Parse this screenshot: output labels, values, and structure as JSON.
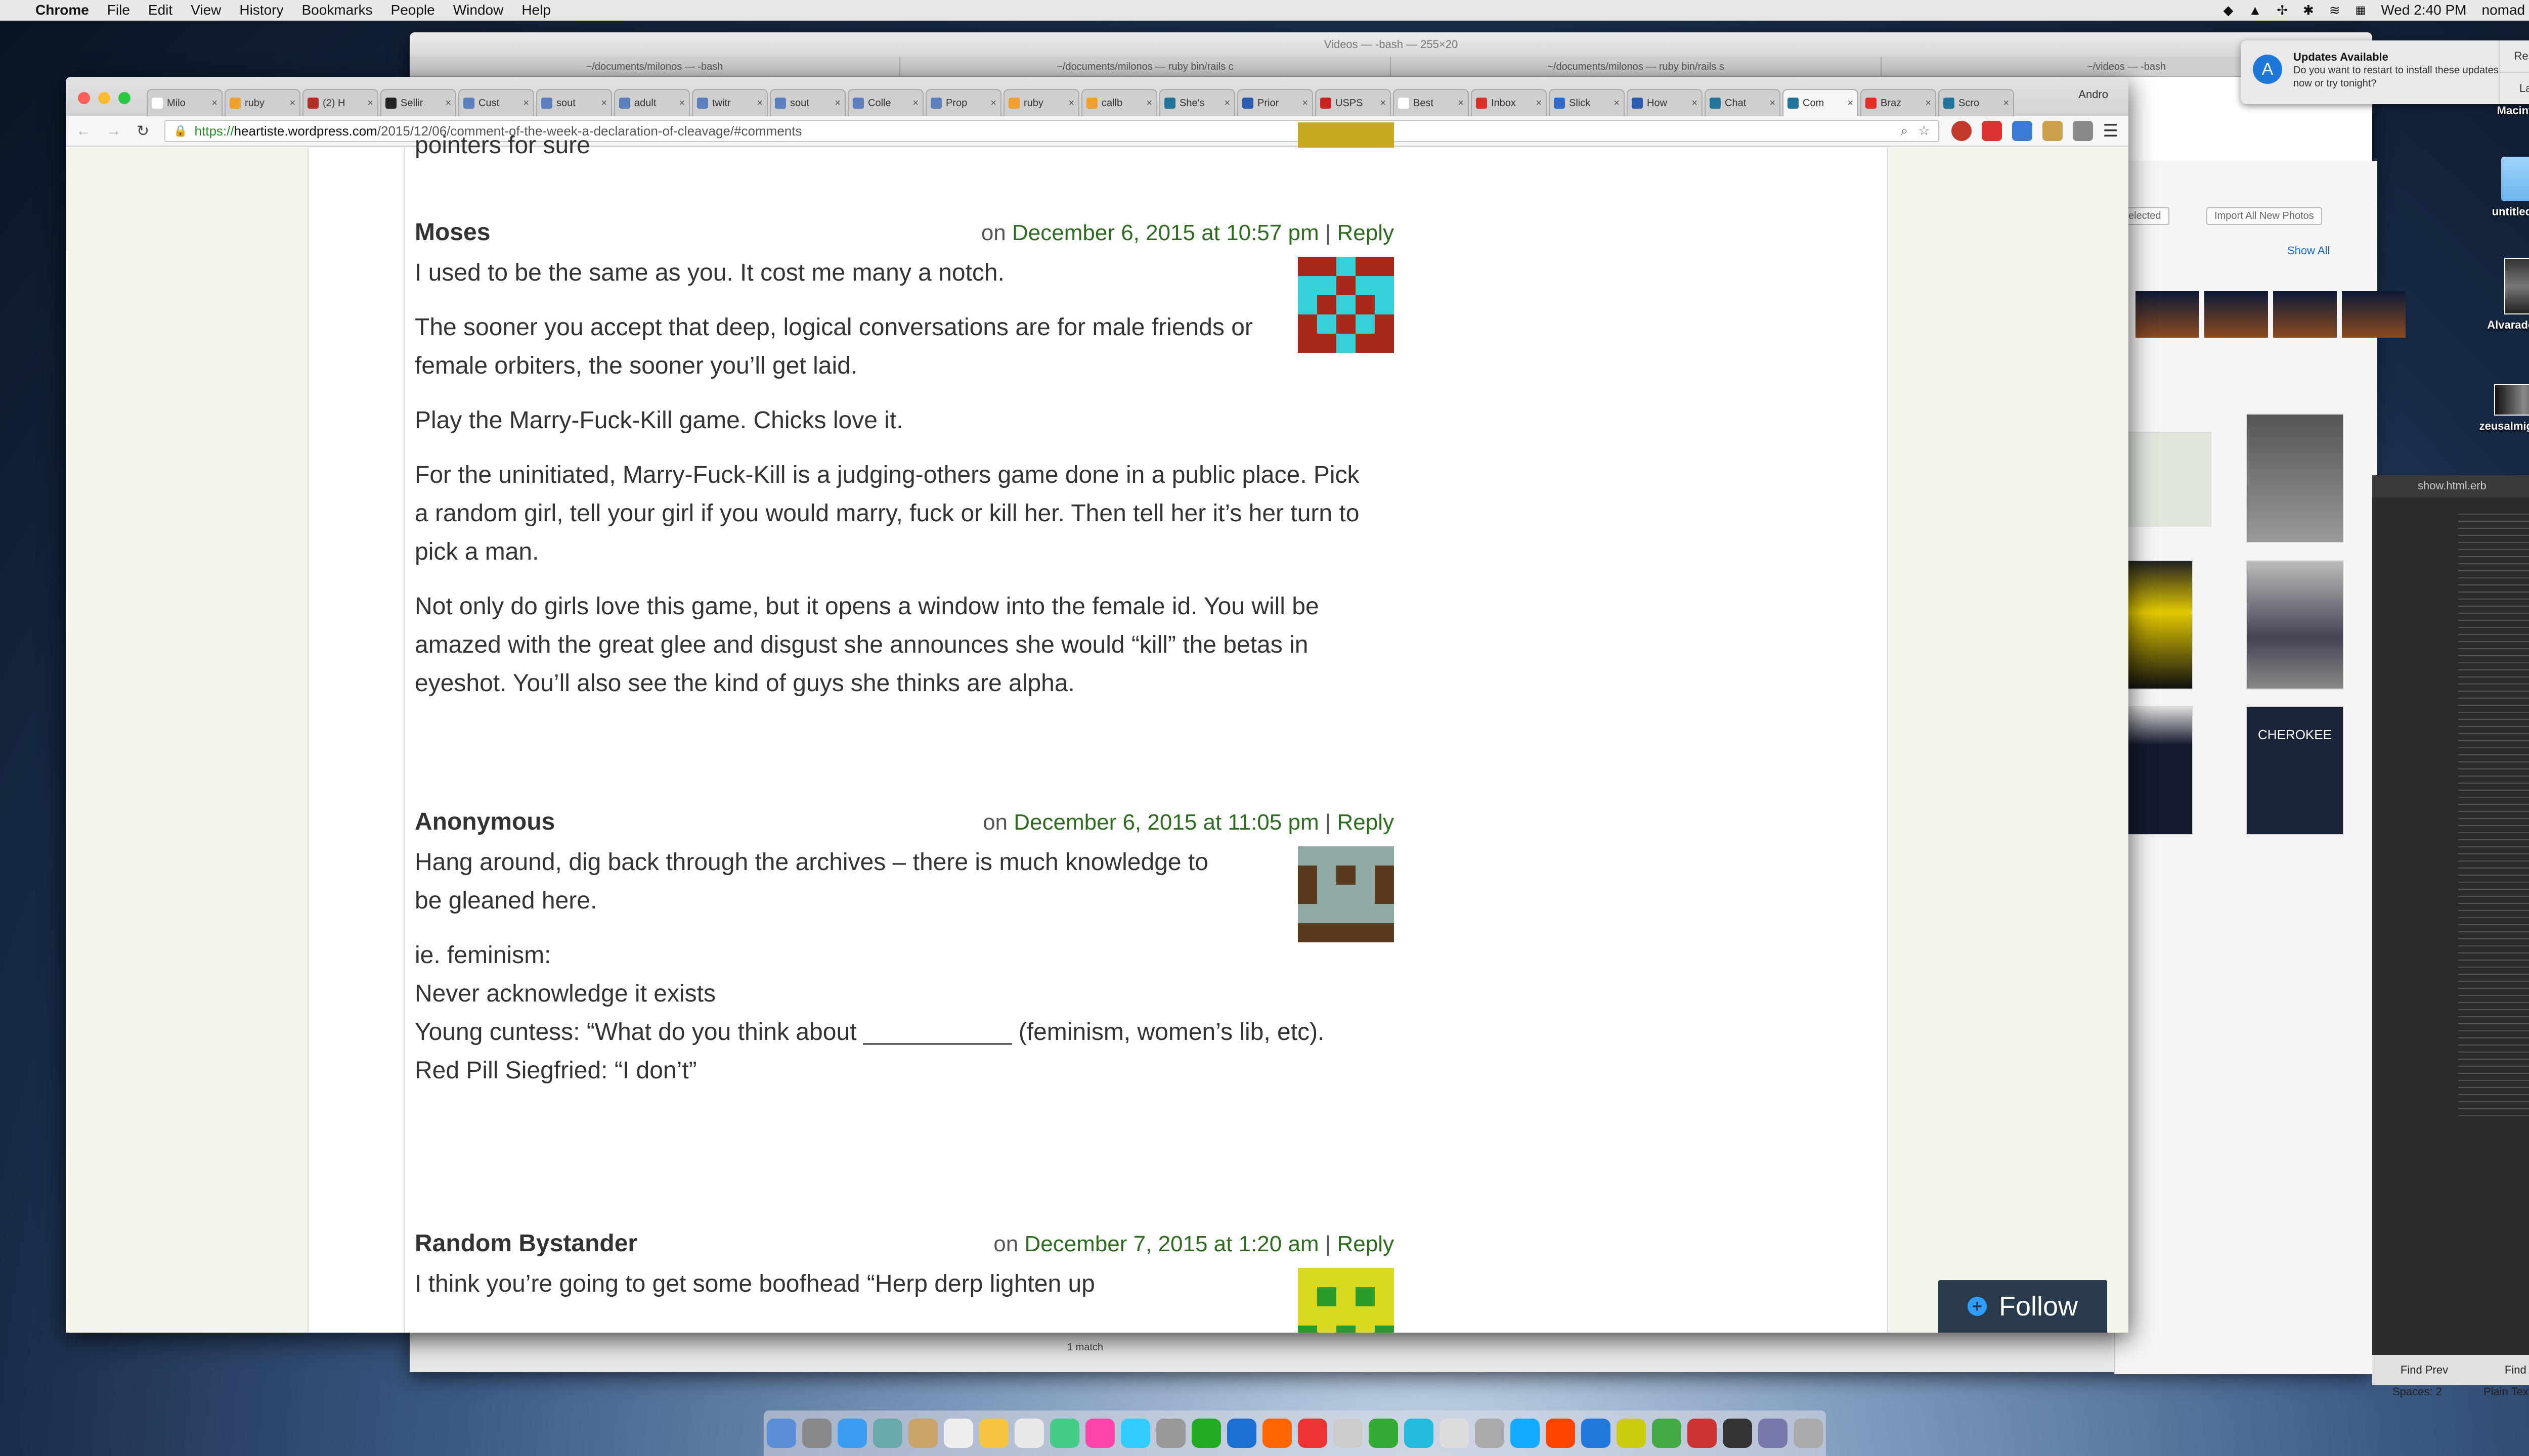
{
  "menubar": {
    "apple": "",
    "items": [
      "Chrome",
      "File",
      "Edit",
      "View",
      "History",
      "Bookmarks",
      "People",
      "Window",
      "Help"
    ],
    "clock": "Wed 2:40 PM",
    "user": "nomad"
  },
  "desktop": {
    "items": [
      "Macintosh HD",
      "untitled folder",
      "Alvarado.jpeg",
      "zeusalmighty.jpg"
    ]
  },
  "notification": {
    "title": "Updates Available",
    "body": "Do you want to restart to install these updates now or try tonight?",
    "restart": "Restart",
    "later": "Later"
  },
  "terminal": {
    "title": "Videos — -bash — 255×20",
    "tabs": [
      "~/documents/milonos — -bash",
      "~/documents/milonos — ruby bin/rails c",
      "~/documents/milonos — ruby bin/rails s",
      "~/videos — -bash"
    ],
    "status": "1 match"
  },
  "photos": {
    "selected": "selected",
    "import": "Import All New Photos",
    "showall": "Show All",
    "cherokee": "CHEROKEE"
  },
  "editor": {
    "tab": "show.html.erb",
    "find_prev": "Find Prev",
    "find_all": "Find All",
    "spaces": "Spaces: 2",
    "mode": "Plain Text"
  },
  "chrome": {
    "profile": "Andro",
    "tabs": [
      {
        "label": "Milo",
        "color": "#ffffff"
      },
      {
        "label": "ruby",
        "color": "#f0a030"
      },
      {
        "label": "(2) H",
        "color": "#b92b27"
      },
      {
        "label": "Sellir",
        "color": "#222222"
      },
      {
        "label": "Cust",
        "color": "#5b7fbd"
      },
      {
        "label": "sout",
        "color": "#5b7fbd"
      },
      {
        "label": "adult",
        "color": "#5b7fbd"
      },
      {
        "label": "twitr",
        "color": "#5b7fbd"
      },
      {
        "label": "sout",
        "color": "#5b7fbd"
      },
      {
        "label": "Colle",
        "color": "#5b7fbd"
      },
      {
        "label": "Prop",
        "color": "#5b7fbd"
      },
      {
        "label": "ruby",
        "color": "#f0a030"
      },
      {
        "label": "callb",
        "color": "#f0a030"
      },
      {
        "label": "She's",
        "color": "#21759b"
      },
      {
        "label": "Prior",
        "color": "#2a5db0"
      },
      {
        "label": "USPS",
        "color": "#cc2222"
      },
      {
        "label": "Best",
        "color": "#ffffff"
      },
      {
        "label": "Inbox",
        "color": "#d93025"
      },
      {
        "label": "Slick",
        "color": "#2a6ad1"
      },
      {
        "label": "How",
        "color": "#2a5db0"
      },
      {
        "label": "Chat",
        "color": "#21759b"
      },
      {
        "label": "Com",
        "color": "#21759b"
      },
      {
        "label": "Braz",
        "color": "#e52d27"
      },
      {
        "label": "Scro",
        "color": "#21759b"
      }
    ],
    "url_https": "https://",
    "url_host": "heartiste.wordpress.com",
    "url_path": "/2015/12/06/comment-of-the-week-a-declaration-of-cleavage/#comments"
  },
  "page": {
    "prev_snippet": "pointers for sure",
    "follow": "Follow",
    "comments": [
      {
        "author": "Moses",
        "on": "on",
        "date": "December 6, 2015 at 10:57 pm",
        "sep": "|",
        "reply": "Reply",
        "paragraphs": [
          "I used to be the same as you. It cost me many a notch.",
          "The sooner you accept that deep, logical conversations are for male friends or female orbiters, the sooner you’ll get laid.",
          "Play the Marry-Fuck-Kill game. Chicks love it.",
          "For the uninitiated, Marry-Fuck-Kill is a judging-others game done in a public place. Pick a random girl, tell your girl if you would marry, fuck or kill her. Then tell her it’s her turn to pick a man.",
          "Not only do girls love this game, but it opens a window into the female id. You will be amazed with the great glee and disgust she announces she would “kill” the betas in eyeshot. You’ll also see the kind of guys she thinks are alpha."
        ],
        "avatar_fg": "#36d0d8",
        "avatar_bg": "#a8281a"
      },
      {
        "author": "Anonymous",
        "on": "on",
        "date": "December 6, 2015 at 11:05 pm",
        "sep": "|",
        "reply": "Reply",
        "paragraphs": [
          "Hang around, dig back through the archives – there is much knowledge to be gleaned here.",
          "ie. feminism:\nNever acknowledge it exists\nYoung cuntess: “What do you think about ___________ (feminism, women’s lib, etc).\nRed Pill Siegfried: “I don’t”"
        ],
        "avatar_fg": "#8fa9a5",
        "avatar_bg": "#5a3a1c"
      },
      {
        "author": "Random Bystander",
        "on": "on",
        "date": "December 7, 2015 at 1:20 am",
        "sep": "|",
        "reply": "Reply",
        "paragraphs": [
          "I think you’re going to get some boofhead “Herp derp lighten up"
        ],
        "avatar_fg": "#d8d820",
        "avatar_bg": "#2a9a2a"
      }
    ]
  }
}
